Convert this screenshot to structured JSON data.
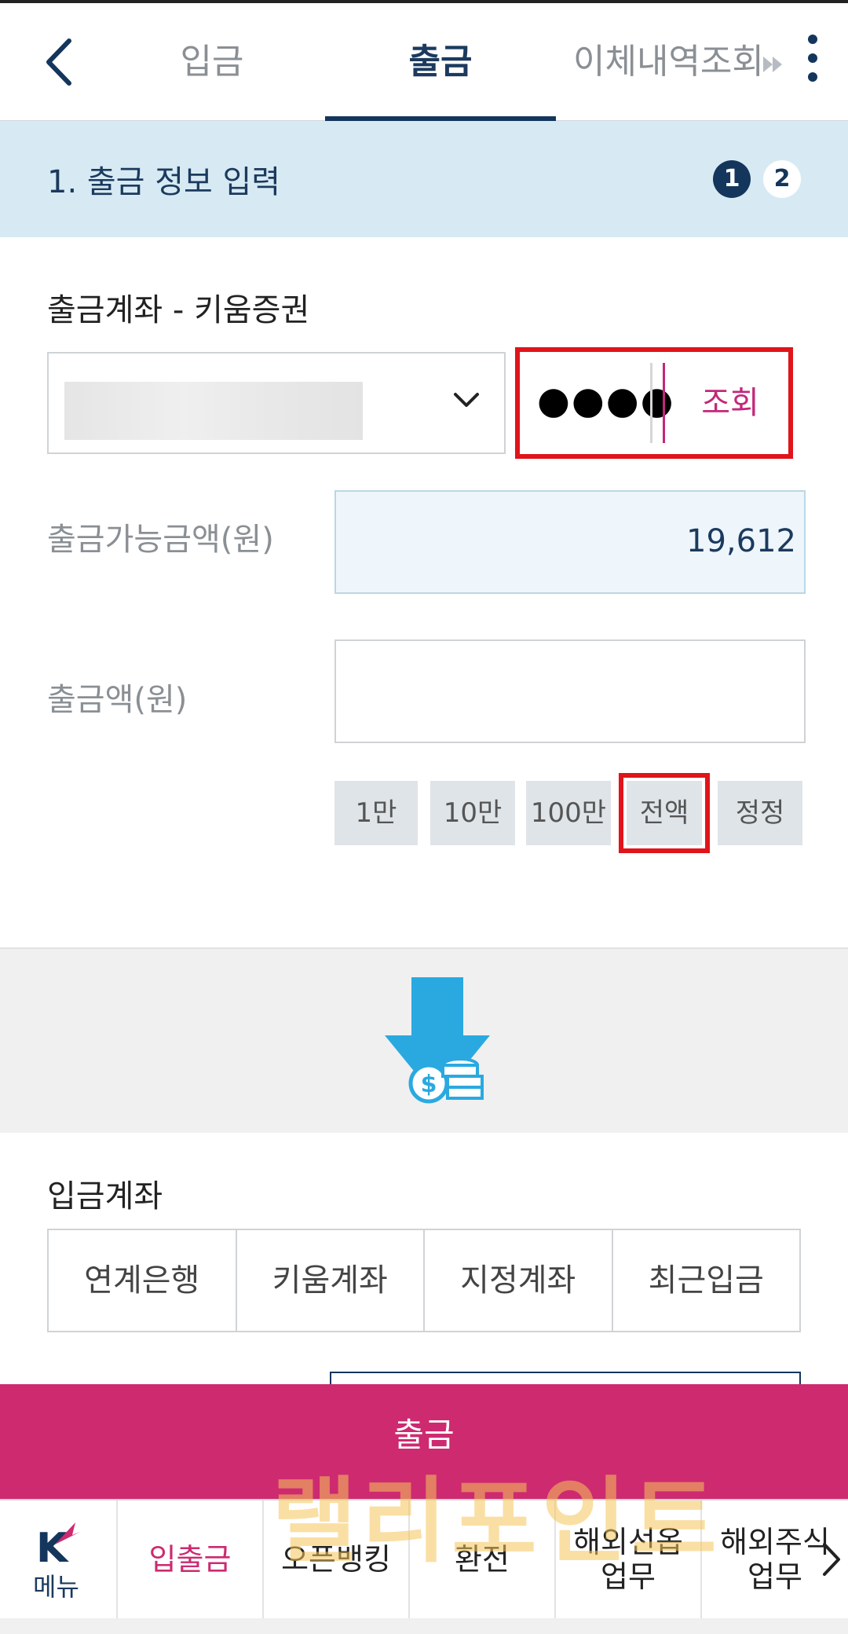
{
  "tabs": [
    {
      "label": "입금",
      "active": false
    },
    {
      "label": "출금",
      "active": true
    },
    {
      "label": "이체내역조회",
      "active": false
    }
  ],
  "step": {
    "title": "1. 출금 정보 입력",
    "current": "1",
    "next": "2"
  },
  "withdraw_account": {
    "label": "출금계좌 - 키움증권",
    "password_mask": "●●●●",
    "query_label": "조회"
  },
  "available": {
    "label": "출금가능금액(원)",
    "value": "19,612"
  },
  "amount": {
    "label": "출금액(원)",
    "value": ""
  },
  "quick_buttons": [
    "1만",
    "10만",
    "100만",
    "전액",
    "정정"
  ],
  "deposit_account": {
    "label": "입금계좌",
    "tabs": [
      "연계은행",
      "키움계좌",
      "지정계좌",
      "최근입금"
    ]
  },
  "withdraw_button_label": "출금",
  "bottom_nav": {
    "menu_label": "메뉴",
    "items": [
      "입출금",
      "오픈뱅킹",
      "환전",
      "해외선옵\n업무",
      "해외주식\n업무"
    ],
    "active_index": 0
  },
  "watermark": "랠리포인트",
  "colors": {
    "navy": "#14365c",
    "accent_magenta": "#cd2a70",
    "highlight_red": "#e0141a",
    "step_bg": "#d7eaf3",
    "arrow_blue": "#2aa9e0"
  }
}
